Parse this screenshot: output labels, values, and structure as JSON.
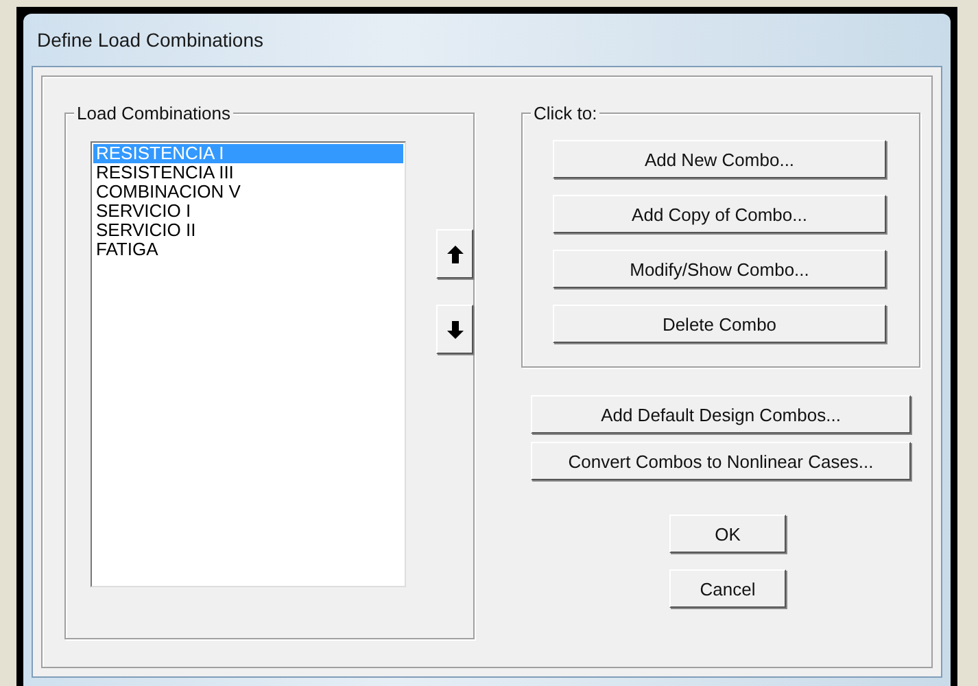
{
  "window": {
    "title": "Define Load Combinations"
  },
  "load_combinations": {
    "label": "Load Combinations",
    "items": [
      {
        "name": "RESISTENCIA I",
        "selected": true
      },
      {
        "name": "RESISTENCIA III",
        "selected": false
      },
      {
        "name": "COMBINACION V",
        "selected": false
      },
      {
        "name": "SERVICIO I",
        "selected": false
      },
      {
        "name": "SERVICIO II",
        "selected": false
      },
      {
        "name": "FATIGA",
        "selected": false
      }
    ]
  },
  "click_to": {
    "label": "Click to:",
    "buttons": [
      "Add New Combo...",
      "Add Copy of Combo...",
      "Modify/Show Combo...",
      "Delete Combo"
    ]
  },
  "extra_buttons": [
    "Add Default Design Combos...",
    "Convert Combos to Nonlinear Cases..."
  ],
  "dialog_buttons": [
    "OK",
    "Cancel"
  ]
}
